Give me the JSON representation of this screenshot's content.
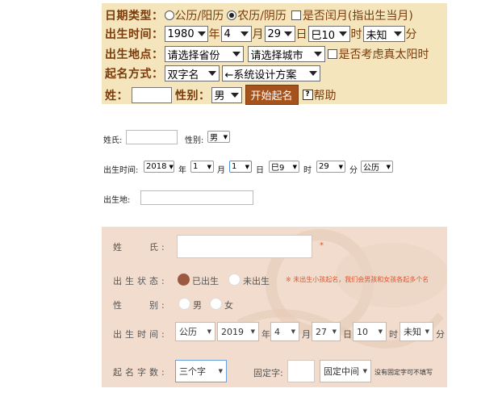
{
  "form1": {
    "date_type_label": "日期类型：",
    "calendar_options": [
      "公历/阳历",
      "农历/阴历"
    ],
    "selected_calendar": "农历/阴历",
    "leap_month_label": "是否闰月(指出生当月)",
    "birth_time_label": "出生时间：",
    "year": "1980",
    "year_unit": "年",
    "month": "4",
    "month_unit": "月",
    "day": "29",
    "day_unit": "日",
    "hour": "巳10",
    "hour_unit": "时",
    "minute": "未知",
    "minute_unit": "分",
    "birthplace_label": "出生地点：",
    "province_placeholder": "请选择省份",
    "city_placeholder": "请选择城市",
    "solar_time_label": "是否考虑真太阳时",
    "naming_method_label": "起名方式：",
    "name_type": "双字名",
    "scheme": "←系统设计方案",
    "surname_label": "姓：",
    "gender_label": "性别：",
    "gender": "男",
    "start_button": "开始起名",
    "help_icon_text": "?",
    "help_label": "帮助"
  },
  "form2": {
    "surname_label": "姓氏:",
    "gender_label": "性别:",
    "gender": "男",
    "birth_time_label": "出生时间:",
    "year": "2018",
    "year_unit": "年",
    "month": "1",
    "month_unit": "月",
    "day": "1",
    "day_unit": "日",
    "hour": "巳9",
    "hour_unit": "时",
    "minute": "29",
    "minute_unit": "分",
    "calendar": "公历",
    "birthplace_label": "出生地:"
  },
  "form3": {
    "surname_label": "姓　　氏:",
    "required_mark": "*",
    "status_label": "出生状态:",
    "status_options": [
      "已出生",
      "未出生"
    ],
    "selected_status": "已出生",
    "status_note": "※ 未出生小孩起名，我们会男孩和女孩各起多个名",
    "gender_label": "性　　别:",
    "gender_options": [
      "男",
      "女"
    ],
    "birth_time_label": "出生时间:",
    "calendar": "公历",
    "year": "2019",
    "year_unit": "年",
    "month": "4",
    "month_unit": "月",
    "day": "27",
    "day_unit": "日",
    "hour": "10",
    "hour_unit": "时",
    "minute": "未知",
    "minute_unit": "分",
    "char_count_label": "起名字数:",
    "char_count": "三个字",
    "fixed_char_label": "固定字:",
    "fixed_position": "固定中间",
    "fixed_note": "没有固定字可不填写"
  },
  "colors": {
    "form1_bg": "#f4e5bd",
    "form1_text": "#7a3a0a",
    "button_bg": "#a6521c",
    "form3_bg": "#f1dccd",
    "accent_red": "#e0542e",
    "radio_selected": "#9b5a40"
  }
}
